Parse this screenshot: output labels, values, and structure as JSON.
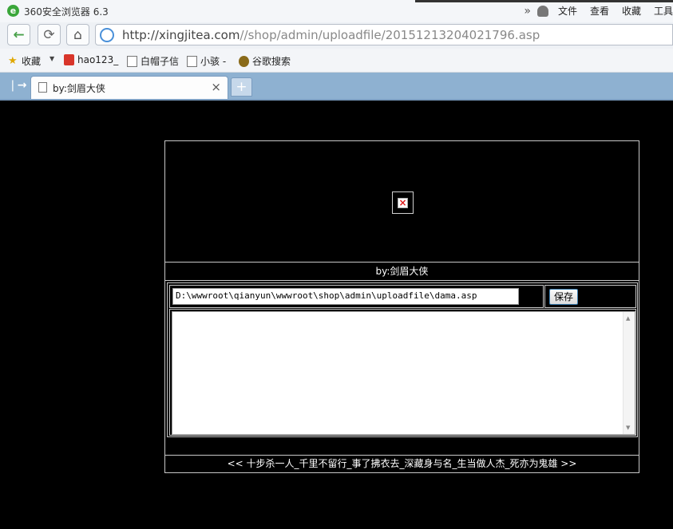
{
  "browser": {
    "title": "360安全浏览器 6.3",
    "menu": {
      "file": "文件",
      "view": "查看",
      "favorites": "收藏",
      "tools": "工具"
    },
    "address": {
      "domain": "http://xingjitea.com",
      "path": "//shop/admin/uploadfile/20151213204021796.asp"
    },
    "favorites_bar": [
      {
        "label": "收藏",
        "icon": "star-icon"
      },
      {
        "label": "hao123_",
        "icon": "hao123-icon"
      },
      {
        "label": "白帽子信",
        "icon": "page-icon"
      },
      {
        "label": "小骇 -",
        "icon": "page-icon"
      },
      {
        "label": "谷歌搜索",
        "icon": "paw-icon"
      }
    ],
    "tab": {
      "label": "by:剑眉大侠",
      "close": "×",
      "new": "+"
    }
  },
  "page": {
    "by_label": "by:剑眉大侠",
    "file_path": "D:\\wwwroot\\qianyun\\wwwroot\\shop\\admin\\uploadfile\\dama.asp",
    "save_label": "保存",
    "content": "",
    "footer": "<< 十步杀一人_千里不留行_事了拂衣去_深藏身与名_生当做人杰_死亦为鬼雄 >>"
  },
  "colors": {
    "page_background": "#000000",
    "border": "#c8c8c8",
    "tabbar": "#8eb1d1",
    "accent_green": "#49a14a"
  }
}
